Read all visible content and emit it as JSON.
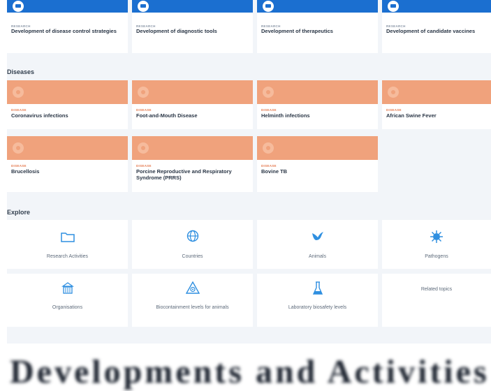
{
  "research_cards": [
    {
      "tag": "RESEARCH",
      "title": "Development of disease control strategies"
    },
    {
      "tag": "RESEARCH",
      "title": "Development of diagnostic tools"
    },
    {
      "tag": "RESEARCH",
      "title": "Development of therapeutics"
    },
    {
      "tag": "RESEARCH",
      "title": "Development of candidate vaccines"
    }
  ],
  "diseases": {
    "heading": "Diseases",
    "items": [
      {
        "tag": "DISEASE",
        "title": "Coronavirus infections"
      },
      {
        "tag": "DISEASE",
        "title": "Foot-and-Mouth Disease"
      },
      {
        "tag": "DISEASE",
        "title": "Helminth infections"
      },
      {
        "tag": "DISEASE",
        "title": "African Swine Fever"
      },
      {
        "tag": "DISEASE",
        "title": "Brucellosis"
      },
      {
        "tag": "DISEASE",
        "title": "Porcine Reproductive and Respiratory Syndrome (PRRS)"
      },
      {
        "tag": "DISEASE",
        "title": "Bovine TB"
      }
    ]
  },
  "explore": {
    "heading": "Explore",
    "items": [
      {
        "label": "Research Activities",
        "icon": "folder-icon"
      },
      {
        "label": "Countries",
        "icon": "globe-icon"
      },
      {
        "label": "Animals",
        "icon": "bird-icon"
      },
      {
        "label": "Pathogens",
        "icon": "virus-icon"
      },
      {
        "label": "Organisations",
        "icon": "building-icon"
      },
      {
        "label": "Biocontainment levels for animals",
        "icon": "biohazard-icon"
      },
      {
        "label": "Laboratory biosafety levels",
        "icon": "flask-icon"
      },
      {
        "label": "Related topics",
        "icon": ""
      }
    ]
  },
  "footer": {
    "text": "Developments & (blurred)"
  },
  "colors": {
    "research": "#1b6fd0",
    "disease": "#f0a27c",
    "icon": "#2f8fe0"
  }
}
